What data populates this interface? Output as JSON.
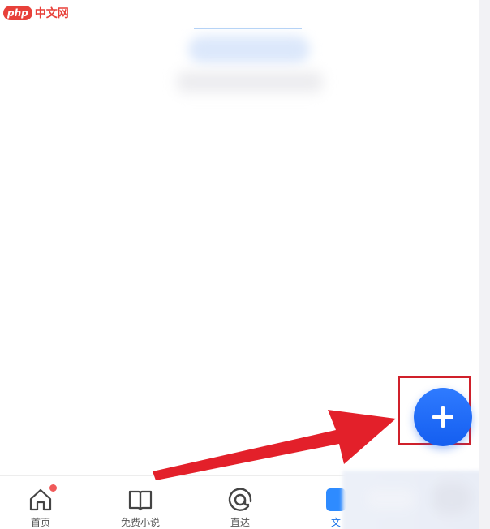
{
  "watermark": {
    "badge": "php",
    "text": "中文网"
  },
  "fab": {
    "icon": "plus-icon",
    "color": "#1a62f2"
  },
  "annotation": {
    "box_color": "#d0202a",
    "arrow_color": "#e3202a"
  },
  "bottom_nav": {
    "items": [
      {
        "label": "首页",
        "icon": "home-icon",
        "has_dot": true
      },
      {
        "label": "免费小说",
        "icon": "book-icon",
        "has_dot": false
      },
      {
        "label": "直达",
        "icon": "at-sign-icon",
        "has_dot": false
      },
      {
        "label": "文",
        "icon": "document-icon",
        "active": true
      }
    ],
    "active_color": "#1a73e8"
  }
}
